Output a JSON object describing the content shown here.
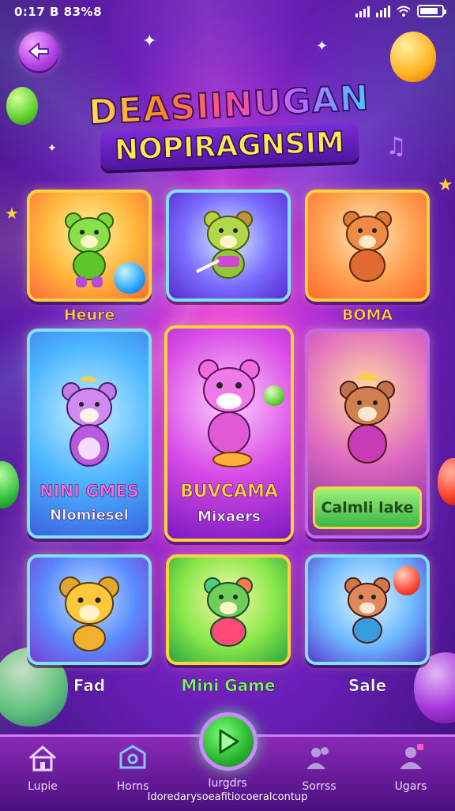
{
  "status": {
    "time": "0:17 B 83%8",
    "battery_level": 0.85
  },
  "title": {
    "line1": "DEASIINUGAN",
    "line2": "NOPIRAGNSIM"
  },
  "cards": [
    {
      "label": "Heure",
      "color": "#ffd23c"
    },
    {
      "label": "",
      "color": "#7fe3ff"
    },
    {
      "label": "BOMA",
      "color": "#ffd23c"
    },
    {
      "label": "NINI GMES",
      "sublabel": "Nlomiesel"
    },
    {
      "label": "BUVCAMA",
      "sublabel": "Mixaers"
    },
    {
      "button": "Calmli lake"
    },
    {
      "label": "Fad"
    },
    {
      "label": "Mini Game"
    },
    {
      "label": "Sale"
    }
  ],
  "nav": {
    "items": [
      {
        "label": "Lupie",
        "icon": "home-icon"
      },
      {
        "label": "Horns",
        "icon": "house-badge-icon"
      },
      {
        "label": "Iurgdrs",
        "icon": "play-icon"
      },
      {
        "label": "Sorrss",
        "icon": "people-icon"
      },
      {
        "label": "Ugars",
        "icon": "user-icon"
      }
    ],
    "footer": "Idoredarysoeafitiocoeralcontup"
  }
}
